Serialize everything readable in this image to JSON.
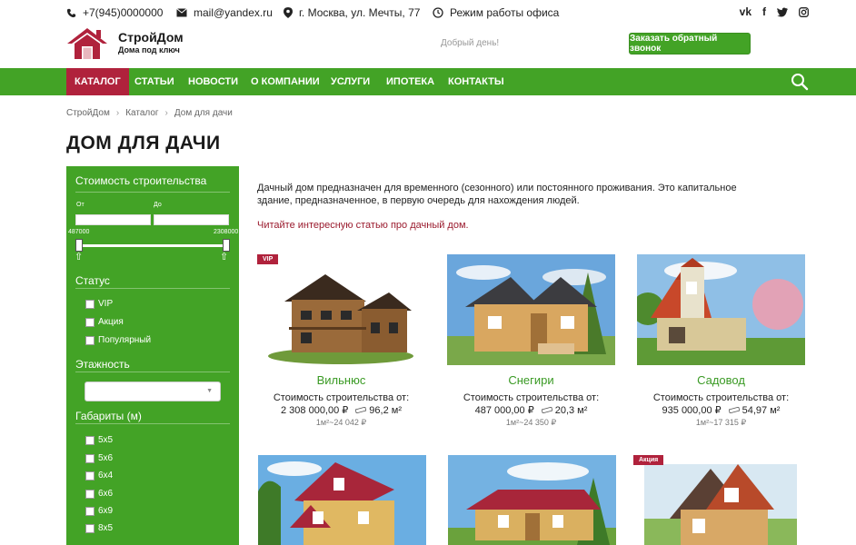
{
  "contacts": {
    "phone": "+7(945)0000000",
    "email": "mail@yandex.ru",
    "address": "г. Москва, ул. Мечты, 77",
    "hours": "Режим работы офиса"
  },
  "social": [
    "vk",
    "f",
    "twitter",
    "instagram"
  ],
  "social_labels": {
    "vk": "vk",
    "fb": "f"
  },
  "logo": {
    "title": "СтройДом",
    "subtitle": "Дома под ключ"
  },
  "greeting": "Добрый день!",
  "callback_button": "Заказать обратный звонок",
  "nav": {
    "items": [
      "Каталог",
      "Статьи",
      "Новости",
      "О компании",
      "Услуги",
      "Ипотека",
      "Контакты"
    ]
  },
  "breadcrumb": [
    "СтройДом",
    "Каталог",
    "Дом для дачи"
  ],
  "page_title": "ДОМ ДЛЯ ДАЧИ",
  "sidebar": {
    "cost_heading": "Стоимость строительства",
    "from_label": "От",
    "to_label": "До",
    "min_value": "487000",
    "max_value": "2308000",
    "status_heading": "Статус",
    "status_options": [
      "VIP",
      "Акция",
      "Популярный"
    ],
    "floors_heading": "Этажность",
    "size_heading": "Габариты (м)",
    "size_options": [
      "5x5",
      "5x6",
      "6x4",
      "6x6",
      "6x9",
      "8x5"
    ]
  },
  "description": "Дачный дом предназначен для временного (сезонного) или постоянного проживания. Это капитальное здание, предназначенное, в первую очередь для нахождения людей.",
  "article_link": "Читайте интересную статью про дачный дом.",
  "cards": [
    {
      "name": "Вильнюс",
      "cost_label": "Стоимость строительства от:",
      "price": "2 308 000,00 ₽",
      "area": "96,2 м²",
      "per_m2": "1м²~24 042 ₽",
      "badge": "VIP"
    },
    {
      "name": "Снегири",
      "cost_label": "Стоимость строительства от:",
      "price": "487 000,00 ₽",
      "area": "20,3 м²",
      "per_m2": "1м²~24 350 ₽",
      "badge": ""
    },
    {
      "name": "Садовод",
      "cost_label": "Стоимость строительства от:",
      "price": "935 000,00 ₽",
      "area": "54,97 м²",
      "per_m2": "1м²~17 315 ₽",
      "badge": ""
    },
    {
      "name": "",
      "cost_label": "",
      "price": "",
      "area": "",
      "per_m2": "",
      "badge": ""
    },
    {
      "name": "",
      "cost_label": "",
      "price": "",
      "area": "",
      "per_m2": "",
      "badge": ""
    },
    {
      "name": "",
      "cost_label": "",
      "price": "",
      "area": "",
      "per_m2": "",
      "badge": "Акция"
    }
  ],
  "colors": {
    "green": "#43a326",
    "crimson": "#b0223c",
    "link": "#9a1a2d"
  }
}
